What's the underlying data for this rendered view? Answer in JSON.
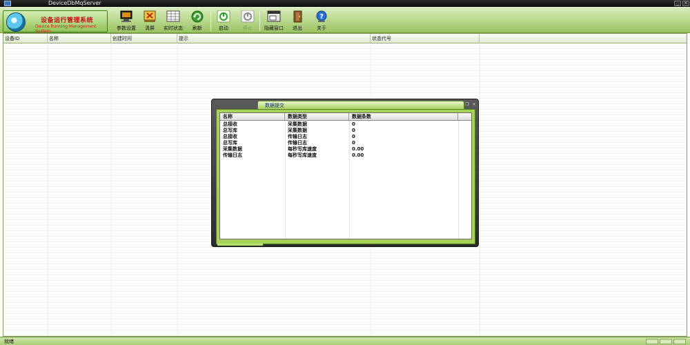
{
  "window": {
    "title": "DeviceDbMqServer"
  },
  "brand": {
    "title": "设备运行管理系统",
    "subtitle": "Device Running Management System"
  },
  "toolbar": [
    {
      "label": "参数设置",
      "icon": "monitor-settings-icon",
      "enabled": true
    },
    {
      "label": "清屏",
      "icon": "clear-screen-icon",
      "enabled": true
    },
    {
      "label": "实时状态",
      "icon": "realtime-status-icon",
      "enabled": true
    },
    {
      "label": "刷新",
      "icon": "refresh-icon",
      "enabled": true
    },
    {
      "label": "启动",
      "icon": "power-start-icon",
      "enabled": true
    },
    {
      "label": "停止",
      "icon": "power-stop-icon",
      "enabled": false
    },
    {
      "label": "隐藏窗口",
      "icon": "hide-window-icon",
      "enabled": true
    },
    {
      "label": "退出",
      "icon": "exit-door-icon",
      "enabled": true
    },
    {
      "label": "关于",
      "icon": "help-icon",
      "enabled": true
    }
  ],
  "grid": {
    "columns": [
      "设备ID",
      "名称",
      "创建时间",
      "提示",
      "状态代号"
    ]
  },
  "dialog": {
    "title": "数据提交",
    "columns": [
      "名称",
      "数据类型",
      "数据条数"
    ],
    "rows": [
      [
        "总接收",
        "采集数据",
        "0"
      ],
      [
        "总写库",
        "采集数据",
        "0"
      ],
      [
        "总接收",
        "传输日志",
        "0"
      ],
      [
        "总写库",
        "传输日志",
        "0"
      ],
      [
        "采集数据",
        "每秒写库速度",
        "0.00"
      ],
      [
        "传输日志",
        "每秒写库速度",
        "0.00"
      ]
    ]
  },
  "status": {
    "text": "就绪"
  },
  "colors": {
    "toolbar": "#b6d68a",
    "accent_green": "#a6d257",
    "brand_red": "#c4121a",
    "dialog_frame": "#2b2b2b"
  }
}
